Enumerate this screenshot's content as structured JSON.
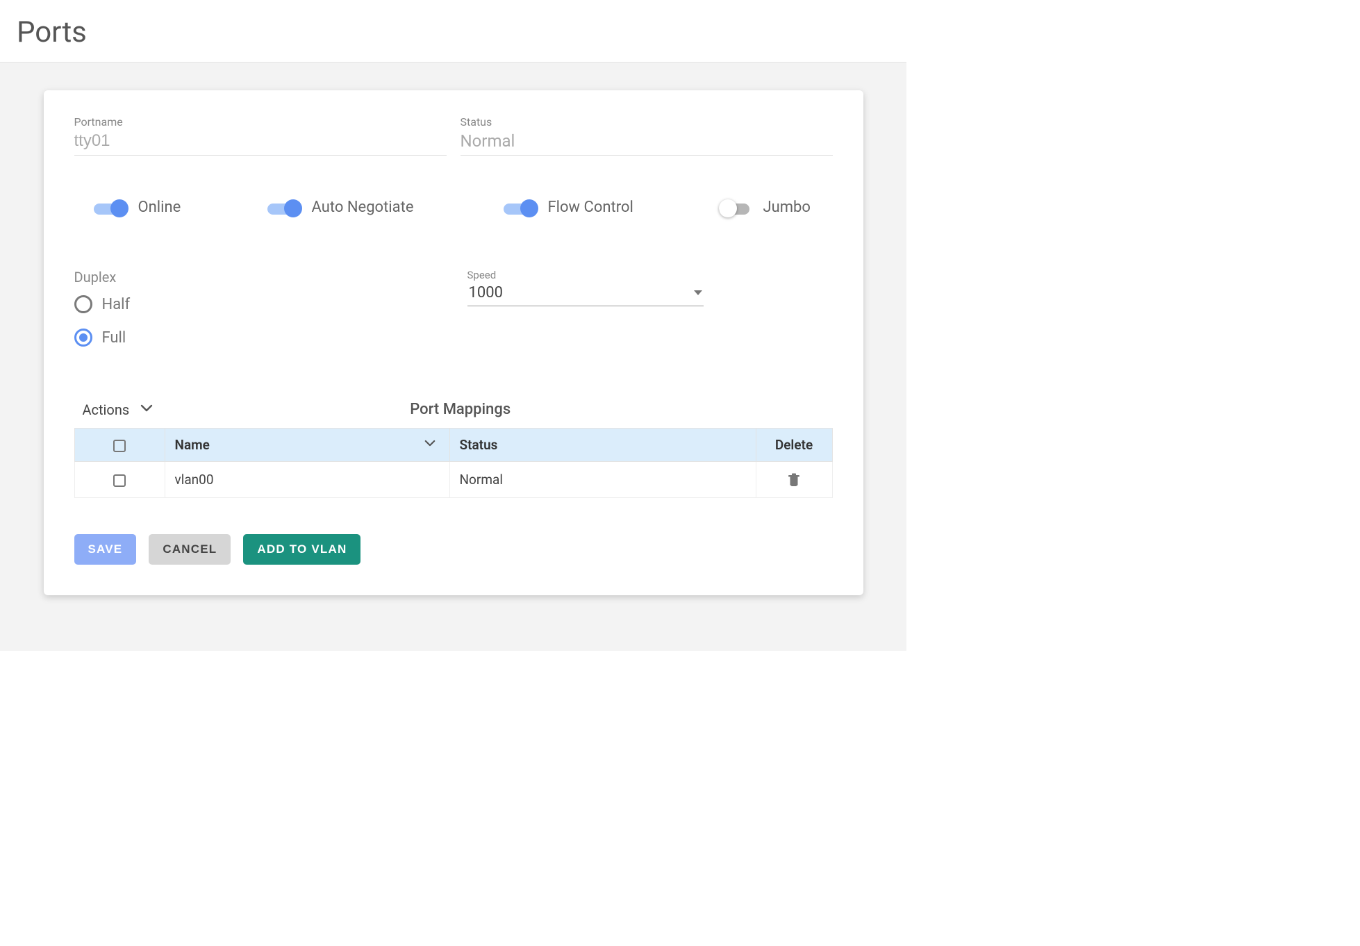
{
  "page": {
    "title": "Ports"
  },
  "fields": {
    "portname": {
      "label": "Portname",
      "value": "tty01"
    },
    "status": {
      "label": "Status",
      "value": "Normal"
    }
  },
  "toggles": {
    "online": {
      "label": "Online",
      "on": true
    },
    "autoNegotiate": {
      "label": "Auto Negotiate",
      "on": true
    },
    "flowControl": {
      "label": "Flow Control",
      "on": true
    },
    "jumbo": {
      "label": "Jumbo",
      "on": false
    }
  },
  "duplex": {
    "label": "Duplex",
    "options": {
      "half": "Half",
      "full": "Full"
    },
    "selected": "full"
  },
  "speed": {
    "label": "Speed",
    "value": "1000"
  },
  "mappings": {
    "actionsLabel": "Actions",
    "title": "Port Mappings",
    "columns": {
      "name": "Name",
      "status": "Status",
      "delete": "Delete"
    },
    "rows": [
      {
        "name": "vlan00",
        "status": "Normal"
      }
    ]
  },
  "buttons": {
    "save": "SAVE",
    "cancel": "CANCEL",
    "addToVlan": "ADD TO VLAN"
  }
}
